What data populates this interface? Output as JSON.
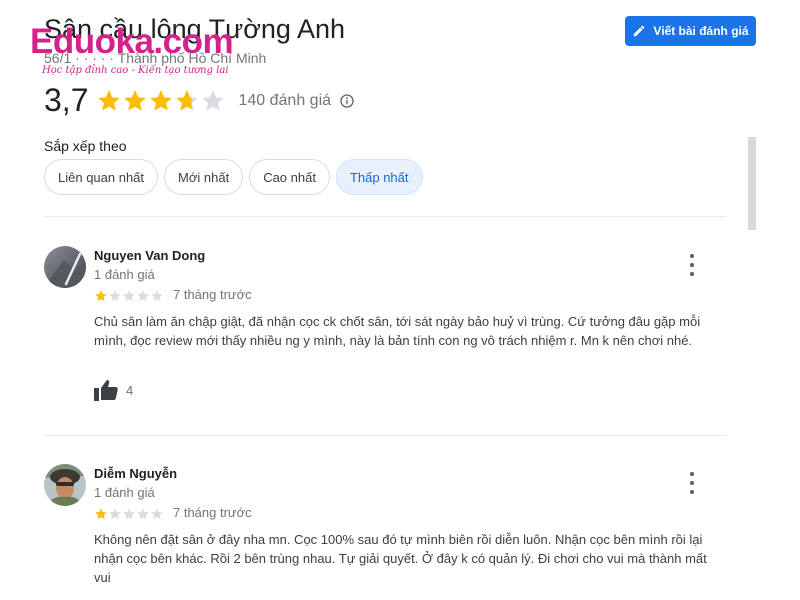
{
  "place": {
    "title": "Sân cầu lông Tường Anh",
    "address": "56/1 · · · · · Thành phố Hồ Chí Minh"
  },
  "watermark": {
    "logo": "Eduoka.com",
    "tagline": "Học tập đỉnh cao - Kiến tạo tương lai"
  },
  "header": {
    "write_review_label": "Viết bài đánh giá"
  },
  "rating": {
    "value": "3,7",
    "stars": 3.7,
    "count_label": "140 đánh giá"
  },
  "sort": {
    "label": "Sắp xếp theo",
    "chips": [
      "Liên quan nhất",
      "Mới nhất",
      "Cao nhất",
      "Thấp nhất"
    ],
    "active": "Thấp nhất"
  },
  "reviews": [
    {
      "name": "Nguyen Van Dong",
      "count": "1 đánh giá",
      "stars": 1,
      "time": "7 tháng trước",
      "text": "Chủ sân làm ăn chập giật, đã nhận cọc ck chốt sân, tới sát ngày bảo huỷ vì trùng. Cứ tưởng đâu gặp mỗi mình, đọc review mới thấy nhiều ng y mình, này là bản tính con ng vô trách nhiệm r. Mn k nên chơi nhé.",
      "likes": "4"
    },
    {
      "name": "Diễm Nguyễn",
      "count": "1 đánh giá",
      "stars": 1,
      "time": "7 tháng trước",
      "text": "Không nên đặt sân ở đây nha mn. Cọc 100% sau đó tự mình biên rồi diễn luôn. Nhận cọc bên mình rồi lại nhận cọc bên khác. Rồi 2 bên trùng nhau. Tự giải quyết. Ở đây k có quản lý. Đi chơi cho vui mà thành mất vui"
    }
  ],
  "colors": {
    "accent": "#1a73e8",
    "star": "#fbbc04",
    "star_empty": "#dadce0",
    "watermark": "#d3238b"
  }
}
